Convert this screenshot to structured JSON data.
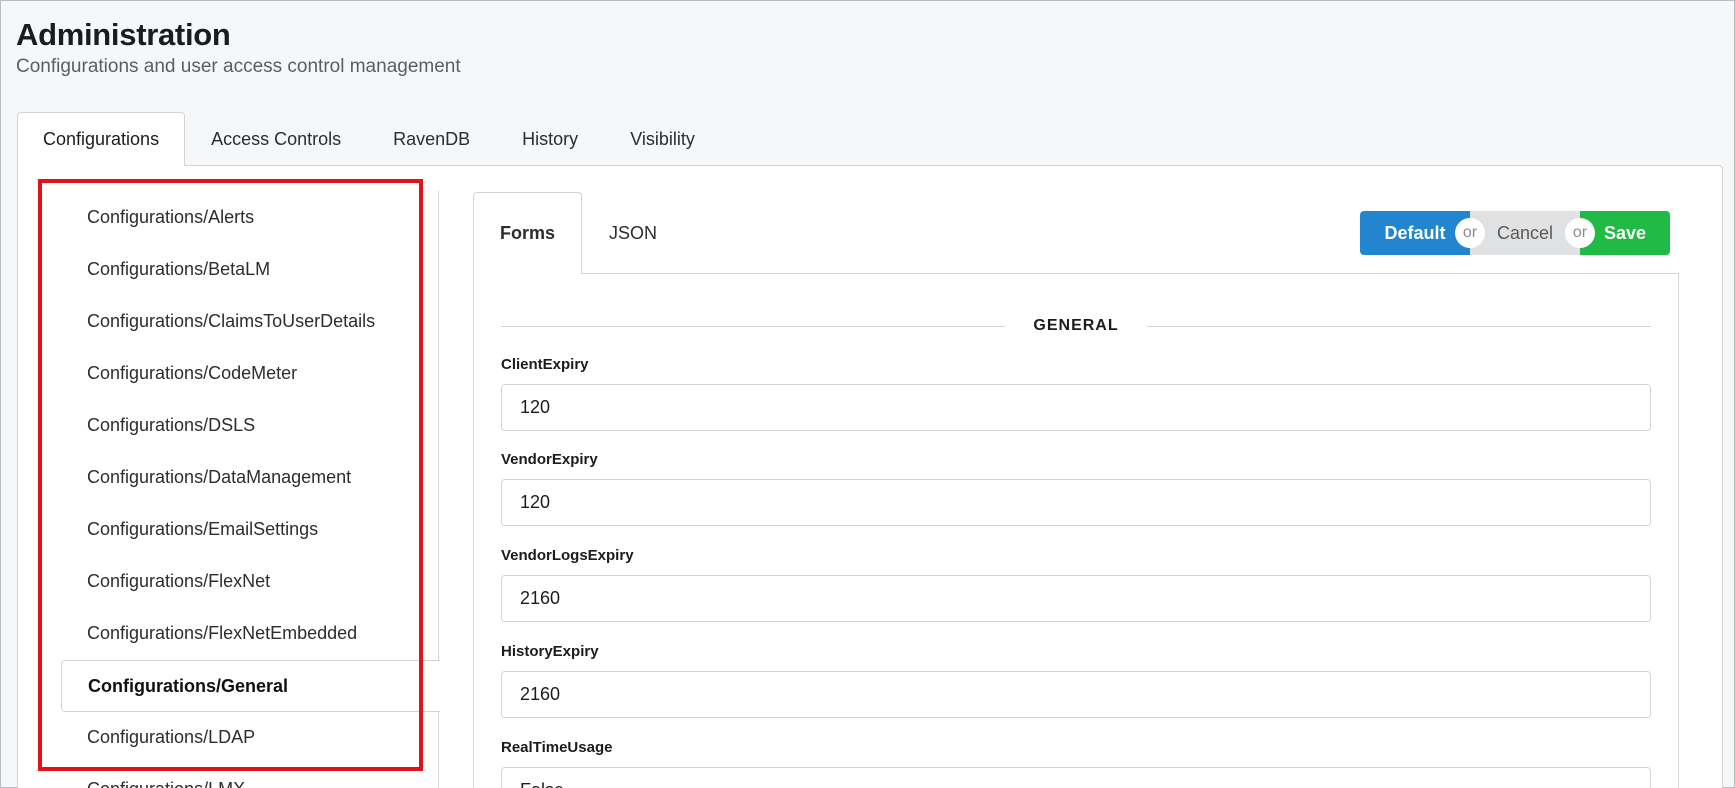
{
  "header": {
    "title": "Administration",
    "subtitle": "Configurations and user access control management"
  },
  "top_tabs": [
    {
      "label": "Configurations",
      "active": true
    },
    {
      "label": "Access Controls",
      "active": false
    },
    {
      "label": "RavenDB",
      "active": false
    },
    {
      "label": "History",
      "active": false
    },
    {
      "label": "Visibility",
      "active": false
    }
  ],
  "side_menu": {
    "items": [
      {
        "label": "Configurations/Alerts"
      },
      {
        "label": "Configurations/BetaLM"
      },
      {
        "label": "Configurations/ClaimsToUserDetails"
      },
      {
        "label": "Configurations/CodeMeter"
      },
      {
        "label": "Configurations/DSLS"
      },
      {
        "label": "Configurations/DataManagement"
      },
      {
        "label": "Configurations/EmailSettings"
      },
      {
        "label": "Configurations/FlexNet"
      },
      {
        "label": "Configurations/FlexNetEmbedded"
      },
      {
        "label": "Configurations/General",
        "active": true
      },
      {
        "label": "Configurations/LDAP"
      },
      {
        "label": "Configurations/LMX"
      }
    ],
    "highlight_color": "#e0121c"
  },
  "inner_tabs": [
    {
      "label": "Forms",
      "active": true
    },
    {
      "label": "JSON",
      "active": false
    }
  ],
  "actions": {
    "default_label": "Default",
    "cancel_label": "Cancel",
    "save_label": "Save",
    "or_label": "or",
    "default_color": "#2185d0",
    "save_color": "#21ba45"
  },
  "form": {
    "section_title": "GENERAL",
    "fields": [
      {
        "label": "ClientExpiry",
        "value": "120"
      },
      {
        "label": "VendorExpiry",
        "value": "120"
      },
      {
        "label": "VendorLogsExpiry",
        "value": "2160"
      },
      {
        "label": "HistoryExpiry",
        "value": "2160"
      },
      {
        "label": "RealTimeUsage",
        "value": "False"
      }
    ]
  }
}
